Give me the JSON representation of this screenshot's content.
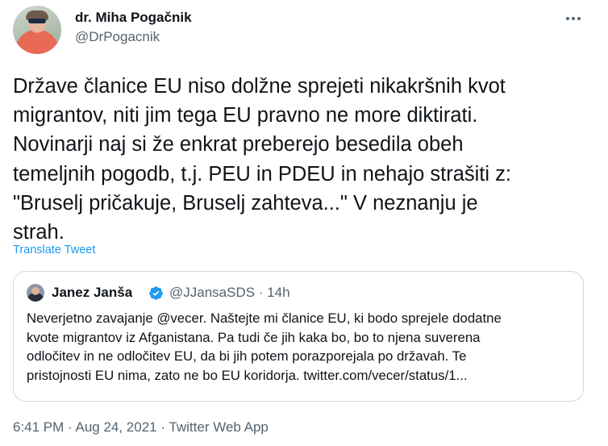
{
  "author": {
    "name": "dr. Miha Pogačnik",
    "handle": "@DrPogacnik"
  },
  "tweet": {
    "text": "Države članice EU niso dolžne sprejeti nikakršnih kvot\nmigrantov, niti jim tega EU pravno ne more diktirati.\nNovinarji naj si že enkrat preberejo besedila obeh\ntemeljnih pogodb, t.j. PEU in PDEU in nehajo strašiti z:\n\"Bruselj pričakuje, Bruselj zahteva...\" V neznanju je\nstrah.",
    "translate_label": "Translate Tweet",
    "meta": "6:41 PM · Aug 24, 2021 · Twitter Web App"
  },
  "quoted_tweet": {
    "name": "Janez Janša",
    "handle_time": "@JJansaSDS · 14h",
    "text": "Neverjetno zavajanje @vecer. Naštejte mi članice EU, ki bodo sprejele dodatne\nkvote migrantov iz Afganistana. Pa tudi če jih kaka bo, bo to njena suverena\nodločitev in ne odločitev EU, da bi jih potem porazporejala po državah. Te\npristojnosti EU nima, zato ne bo EU koridorja. twitter.com/vecer/status/1..."
  },
  "icons": {
    "more": "more-dots-icon",
    "verified": "verified-badge-icon"
  },
  "colors": {
    "link": "#1d9bf0",
    "secondary_text": "#536471",
    "border": "#cfd9de"
  }
}
